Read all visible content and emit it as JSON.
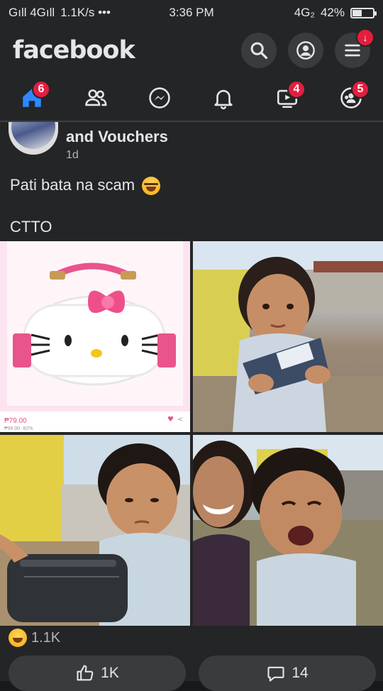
{
  "status_bar": {
    "signal": "Gıll 4Gıll",
    "speed": "1.1K/s •••",
    "time": "3:36 PM",
    "network": "4G₂",
    "battery_percent": "42%",
    "battery_level": 0.42
  },
  "app_bar": {
    "logo": "facebook",
    "menu_badge": "↓"
  },
  "tabs": [
    {
      "name": "home",
      "badge": "6"
    },
    {
      "name": "friends",
      "badge": ""
    },
    {
      "name": "messenger",
      "badge": ""
    },
    {
      "name": "notifications",
      "badge": ""
    },
    {
      "name": "watch",
      "badge": "4"
    },
    {
      "name": "groups",
      "badge": "5"
    }
  ],
  "post": {
    "title": "and Vouchers",
    "time": "1d",
    "text_line1": "Pati bata na scam",
    "text_line2": "CTTO",
    "photo1_price": "₱79.00",
    "photo1_old_price": "₱99.00 -82%",
    "reaction_count": "1.1K",
    "like_count": "1K",
    "comment_count": "14"
  },
  "colors": {
    "background": "#18191a",
    "surface": "#242526",
    "button": "#3a3b3c",
    "accent": "#2d88ff",
    "badge": "#e41e3f"
  }
}
